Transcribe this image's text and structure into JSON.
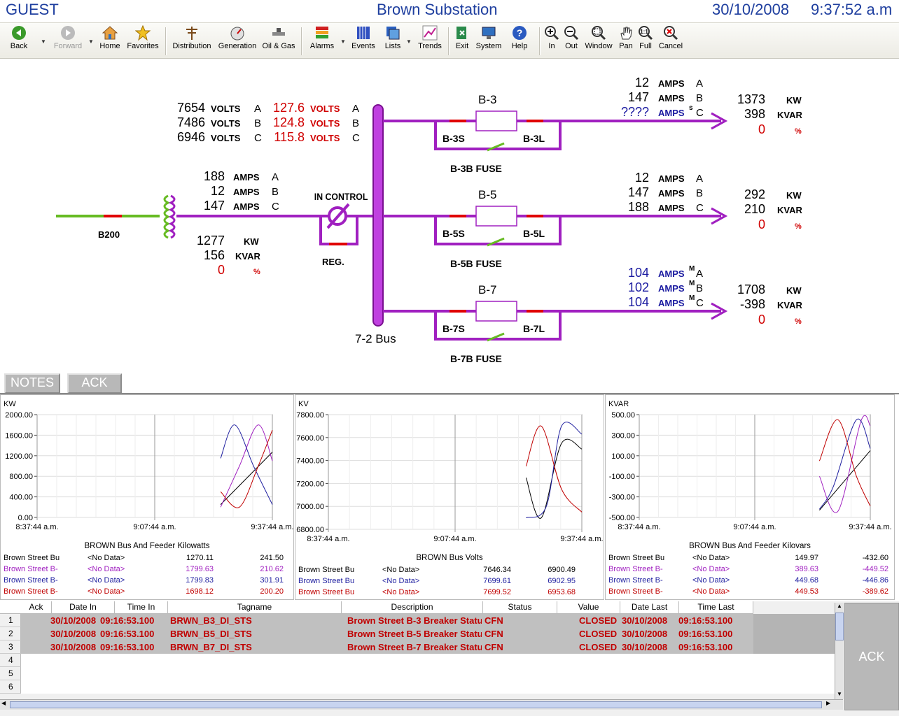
{
  "header": {
    "user": "GUEST",
    "title": "Brown Substation",
    "date": "30/10/2008",
    "time": "9:37:52 a.m"
  },
  "toolbar": {
    "back": "Back",
    "forward": "Forward",
    "home": "Home",
    "favorites": "Favorites",
    "distribution": "Distribution",
    "generation": "Generation",
    "oil_gas": "Oil & Gas",
    "alarms": "Alarms",
    "events": "Events",
    "lists": "Lists",
    "trends": "Trends",
    "exit": "Exit",
    "system": "System",
    "help": "Help",
    "zoom_in": "In",
    "zoom_out": "Out",
    "window": "Window",
    "pan": "Pan",
    "full": "Full",
    "cancel": "Cancel"
  },
  "diagram": {
    "incoming": {
      "volts": [
        {
          "v": "7654",
          "u": "VOLTS",
          "p": "A"
        },
        {
          "v": "7486",
          "u": "VOLTS",
          "p": "B"
        },
        {
          "v": "6946",
          "u": "VOLTS",
          "p": "C"
        }
      ],
      "volts2": [
        {
          "v": "127.6",
          "u": "VOLTS",
          "p": "A"
        },
        {
          "v": "124.8",
          "u": "VOLTS",
          "p": "B"
        },
        {
          "v": "115.8",
          "u": "VOLTS",
          "p": "C"
        }
      ],
      "amps": [
        {
          "v": "188",
          "u": "AMPS",
          "p": "A"
        },
        {
          "v": "12",
          "u": "AMPS",
          "p": "B"
        },
        {
          "v": "147",
          "u": "AMPS",
          "p": "C"
        }
      ],
      "kw": "1277",
      "kw_unit": "KW",
      "kvar": "156",
      "kvar_unit": "KVAR",
      "pct": "0",
      "pct_unit": "%",
      "breaker": "B200",
      "reg_status": "IN CONTROL",
      "reg": "REG.",
      "bus": "7-2 Bus"
    },
    "feeders": [
      {
        "name": "B-3",
        "s": "B-3S",
        "l": "B-3L",
        "fuse": "B-3B FUSE",
        "amps": [
          {
            "v": "12",
            "u": "AMPS",
            "f": "",
            "p": "A"
          },
          {
            "v": "147",
            "u": "AMPS",
            "f": "",
            "p": "B"
          },
          {
            "v": "????",
            "u": "AMPS",
            "f": "s",
            "p": "C"
          }
        ],
        "kw": "1373",
        "kvar": "398",
        "pct": "0"
      },
      {
        "name": "B-5",
        "s": "B-5S",
        "l": "B-5L",
        "fuse": "B-5B FUSE",
        "amps": [
          {
            "v": "12",
            "u": "AMPS",
            "f": "",
            "p": "A"
          },
          {
            "v": "147",
            "u": "AMPS",
            "f": "",
            "p": "B"
          },
          {
            "v": "188",
            "u": "AMPS",
            "f": "",
            "p": "C"
          }
        ],
        "kw": "292",
        "kvar": "210",
        "pct": "0"
      },
      {
        "name": "B-7",
        "s": "B-7S",
        "l": "B-7L",
        "fuse": "B-7B FUSE",
        "amps": [
          {
            "v": "104",
            "u": "AMPS",
            "f": "M",
            "p": "A"
          },
          {
            "v": "102",
            "u": "AMPS",
            "f": "M",
            "p": "B"
          },
          {
            "v": "104",
            "u": "AMPS",
            "f": "M",
            "p": "C"
          }
        ],
        "kw": "1708",
        "kvar": "-398",
        "pct": "0"
      }
    ],
    "units": {
      "kw": "KW",
      "kvar": "KVAR",
      "pct": "%"
    }
  },
  "buttons": {
    "notes": "NOTES",
    "ack": "ACK",
    "ack_big": "ACK"
  },
  "chart_data": [
    {
      "type": "line",
      "ylabel": "KW",
      "title": "BROWN Bus And Feeder Kilowatts",
      "ylim": [
        0,
        2000
      ],
      "yticks": [
        "2000.00",
        "1600.00",
        "1200.00",
        "800.00",
        "400.00",
        "0.00"
      ],
      "xticks": [
        "8:37:44 a.m.",
        "9:07:44 a.m.",
        "9:37:44 a.m."
      ],
      "series": [
        {
          "name": "Brown Street Bu",
          "color": "#000000",
          "x": [
            0.78,
            1.0
          ],
          "y": [
            250,
            1270
          ]
        },
        {
          "name": "Brown Street B-",
          "color": "#a020c0",
          "x": [
            0.78,
            0.86,
            0.94,
            1.0
          ],
          "y": [
            200,
            1000,
            1800,
            1100
          ]
        },
        {
          "name": "Brown Street B-",
          "color": "#2020a0",
          "x": [
            0.78,
            0.84,
            0.92,
            1.0
          ],
          "y": [
            1150,
            1800,
            1000,
            250
          ]
        },
        {
          "name": "Brown Street B-",
          "color": "#c00000",
          "x": [
            0.78,
            0.86,
            0.94,
            1.0
          ],
          "y": [
            500,
            200,
            1000,
            1700
          ]
        }
      ],
      "legend": [
        {
          "name": "Brown Street Bu",
          "nodata": "<No Data>",
          "v1": "1270.11",
          "v2": "241.50",
          "color": "#000000"
        },
        {
          "name": "Brown Street B-",
          "nodata": "<No Data>",
          "v1": "1799.63",
          "v2": "210.62",
          "color": "#a020c0"
        },
        {
          "name": "Brown Street B-",
          "nodata": "<No Data>",
          "v1": "1799.83",
          "v2": "301.91",
          "color": "#2020a0"
        },
        {
          "name": "Brown Street B-",
          "nodata": "<No Data>",
          "v1": "1698.12",
          "v2": "200.20",
          "color": "#c00000"
        }
      ]
    },
    {
      "type": "line",
      "ylabel": "KV",
      "title": "BROWN Bus Volts",
      "ylim": [
        6800,
        7800
      ],
      "yticks": [
        "7800.00",
        "7600.00",
        "7400.00",
        "7200.00",
        "7000.00",
        "6800.00"
      ],
      "xticks": [
        "8:37:44 a.m.",
        "9:07:44 a.m.",
        "9:37:44 a.m."
      ],
      "series": [
        {
          "name": "Brown Street Bu",
          "color": "#000000",
          "x": [
            0.78,
            0.84,
            0.92,
            1.0
          ],
          "y": [
            7250,
            6900,
            7550,
            7500
          ]
        },
        {
          "name": "Brown Street Bu",
          "color": "#2020a0",
          "x": [
            0.78,
            0.86,
            0.92,
            1.0
          ],
          "y": [
            6900,
            7000,
            7700,
            7630
          ]
        },
        {
          "name": "Brown Street Bu",
          "color": "#c00000",
          "x": [
            0.78,
            0.84,
            0.92,
            1.0
          ],
          "y": [
            7350,
            7700,
            7150,
            6950
          ]
        }
      ],
      "legend": [
        {
          "name": "Brown Street Bu",
          "nodata": "<No Data>",
          "v1": "7646.34",
          "v2": "6900.49",
          "color": "#000000"
        },
        {
          "name": "Brown Street Bu",
          "nodata": "<No Data>",
          "v1": "7699.61",
          "v2": "6902.95",
          "color": "#2020a0"
        },
        {
          "name": "Brown Street Bu",
          "nodata": "<No Data>",
          "v1": "7699.52",
          "v2": "6953.68",
          "color": "#c00000"
        }
      ]
    },
    {
      "type": "line",
      "ylabel": "KVAR",
      "title": "BROWN Bus And Feeder Kilovars",
      "ylim": [
        -500,
        500
      ],
      "yticks": [
        "500.00",
        "300.00",
        "100.00",
        "-100.00",
        "-300.00",
        "-500.00"
      ],
      "xticks": [
        "8:37:44 a.m.",
        "9:07:44 a.m.",
        "9:37:44 a.m."
      ],
      "series": [
        {
          "name": "Brown Street Bu",
          "color": "#000000",
          "x": [
            0.78,
            1.0
          ],
          "y": [
            -430,
            150
          ]
        },
        {
          "name": "Brown Street B-",
          "color": "#a020c0",
          "x": [
            0.78,
            0.86,
            0.96,
            1.0
          ],
          "y": [
            -100,
            -440,
            440,
            390
          ]
        },
        {
          "name": "Brown Street B-",
          "color": "#2020a0",
          "x": [
            0.78,
            0.84,
            0.94,
            1.0
          ],
          "y": [
            -420,
            -200,
            450,
            170
          ]
        },
        {
          "name": "Brown Street B-",
          "color": "#c00000",
          "x": [
            0.78,
            0.86,
            0.94,
            1.0
          ],
          "y": [
            50,
            450,
            -100,
            -390
          ]
        }
      ],
      "legend": [
        {
          "name": "Brown Street Bu",
          "nodata": "<No Data>",
          "v1": "149.97",
          "v2": "-432.60",
          "color": "#000000"
        },
        {
          "name": "Brown Street B-",
          "nodata": "<No Data>",
          "v1": "389.63",
          "v2": "-449.52",
          "color": "#a020c0"
        },
        {
          "name": "Brown Street B-",
          "nodata": "<No Data>",
          "v1": "449.68",
          "v2": "-446.86",
          "color": "#2020a0"
        },
        {
          "name": "Brown Street B-",
          "nodata": "<No Data>",
          "v1": "449.53",
          "v2": "-389.62",
          "color": "#c00000"
        }
      ]
    }
  ],
  "alarms": {
    "headers": [
      "Ack",
      "Date In",
      "Time In",
      "Tagname",
      "Description",
      "Status",
      "Value",
      "Date Last",
      "Time Last"
    ],
    "rows": [
      {
        "n": "1",
        "date_in": "30/10/2008",
        "time_in": "09:16:53.100",
        "tag": "BRWN_B3_DI_STS",
        "desc": "Brown Street B-3 Breaker Statu",
        "status": "CFN",
        "value": "CLOSED",
        "date_last": "30/10/2008",
        "time_last": "09:16:53.100"
      },
      {
        "n": "2",
        "date_in": "30/10/2008",
        "time_in": "09:16:53.100",
        "tag": "BRWN_B5_DI_STS",
        "desc": "Brown Street B-5 Breaker Statu",
        "status": "CFN",
        "value": "CLOSED",
        "date_last": "30/10/2008",
        "time_last": "09:16:53.100"
      },
      {
        "n": "3",
        "date_in": "30/10/2008",
        "time_in": "09:16:53.100",
        "tag": "BRWN_B7_DI_STS",
        "desc": "Brown Street B-7 Breaker Statu",
        "status": "CFN",
        "value": "CLOSED",
        "date_last": "30/10/2008",
        "time_last": "09:16:53.100"
      }
    ],
    "empty_rows": [
      "4",
      "5",
      "6"
    ]
  },
  "colors": {
    "bus": "#a020c0",
    "feed": "#66bb22",
    "breaker_red": "#e00000",
    "value_blue": "#1a1aa0",
    "value_red": "#d00000",
    "title_blue": "#1f3f9f"
  }
}
